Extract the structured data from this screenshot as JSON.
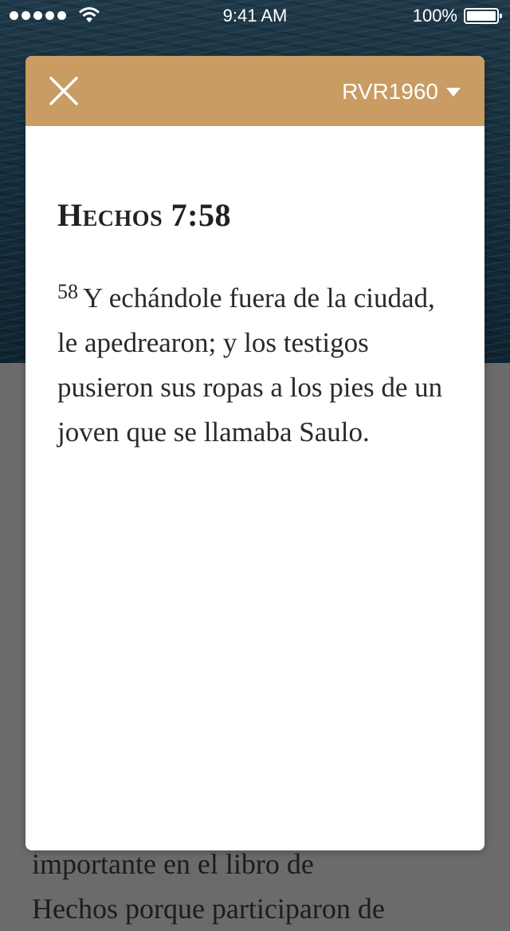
{
  "status_bar": {
    "time": "9:41 AM",
    "battery": "100%"
  },
  "background": {
    "text_lines": [
      "importante en el libro de",
      "Hechos porque participaron de"
    ]
  },
  "modal": {
    "version_label": "RVR1960",
    "reference": "Hechos 7:58",
    "verse_number": "58",
    "verse_text": "Y echándole fuera de la ciudad, le apedrearon; y los testigos pusieron sus ropas a los pies de un joven que se llamaba Saulo."
  },
  "colors": {
    "header": "#c89c62",
    "overlay": "#6b6b6b",
    "text": "#2a2a2a"
  },
  "icons": [
    "signal-icon",
    "wifi-icon",
    "battery-icon",
    "close-icon",
    "caret-down-icon"
  ]
}
